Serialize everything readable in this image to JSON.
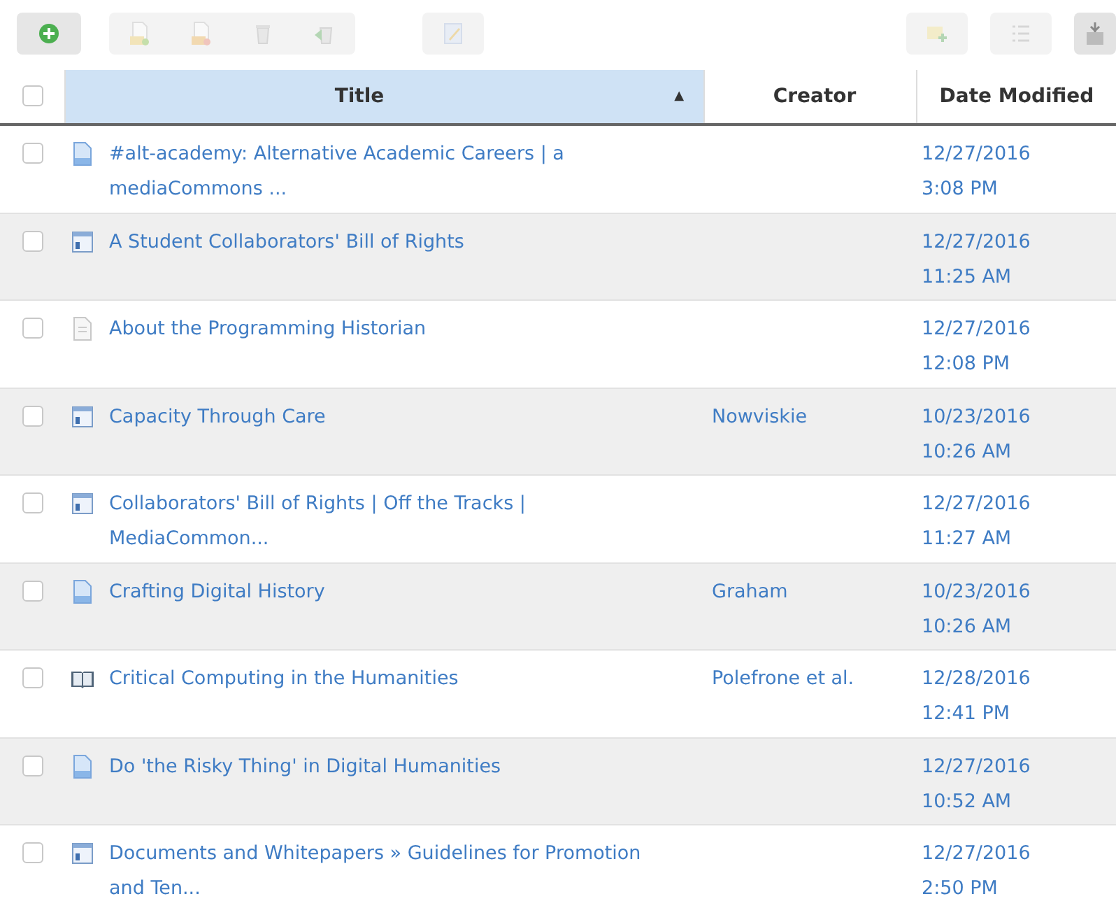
{
  "toolbar": [
    {
      "kind": "add",
      "disabled": false
    },
    {
      "kind": "new-doc",
      "disabled": true
    },
    {
      "kind": "new-note",
      "disabled": true
    },
    {
      "kind": "trash",
      "disabled": true
    },
    {
      "kind": "restore",
      "disabled": true
    },
    {
      "kind": "edit",
      "disabled": true
    },
    {
      "kind": "insert",
      "disabled": true
    },
    {
      "kind": "list",
      "disabled": true
    },
    {
      "kind": "export",
      "disabled": false
    }
  ],
  "table": {
    "all_checked": false,
    "columns": [
      {
        "label": "Title",
        "selected": true,
        "sort_mark": "▲"
      },
      {
        "label": "Creator",
        "selected": false
      },
      {
        "label": "Date Modified",
        "selected": false
      }
    ],
    "rows": [
      {
        "kind": "webpage",
        "checked": false,
        "title": "#alt-academy: Alternative Academic Careers | a mediaCommons ...",
        "creator": "",
        "date": "12/27/2016",
        "time": "3:08 PM"
      },
      {
        "kind": "blog",
        "checked": false,
        "title": "A Student Collaborators' Bill of Rights",
        "creator": "",
        "date": "12/27/2016",
        "time": "11:25 AM"
      },
      {
        "kind": "document",
        "checked": false,
        "title": "About the Programming Historian",
        "creator": "",
        "date": "12/27/2016",
        "time": "12:08 PM"
      },
      {
        "kind": "blog",
        "checked": false,
        "title": "Capacity Through Care",
        "creator": "Nowviskie",
        "date": "10/23/2016",
        "time": "10:26 AM"
      },
      {
        "kind": "blog",
        "checked": false,
        "title": "Collaborators' Bill of Rights | Off the Tracks | MediaCommon...",
        "creator": "",
        "date": "12/27/2016",
        "time": "11:27 AM"
      },
      {
        "kind": "webpage",
        "checked": false,
        "title": "Crafting Digital History",
        "creator": "Graham",
        "date": "10/23/2016",
        "time": "10:26 AM"
      },
      {
        "kind": "book",
        "checked": false,
        "title": "Critical Computing in the Humanities",
        "creator": "Polefrone et al.",
        "date": "12/28/2016",
        "time": "12:41 PM"
      },
      {
        "kind": "webpage",
        "checked": false,
        "title": "Do 'the Risky Thing' in Digital Humanities",
        "creator": "",
        "date": "12/27/2016",
        "time": "10:52 AM"
      },
      {
        "kind": "blog",
        "checked": false,
        "title": "Documents and Whitepapers » Guidelines for Promotion and Ten...",
        "creator": "",
        "date": "12/27/2016",
        "time": "2:50 PM"
      }
    ]
  }
}
